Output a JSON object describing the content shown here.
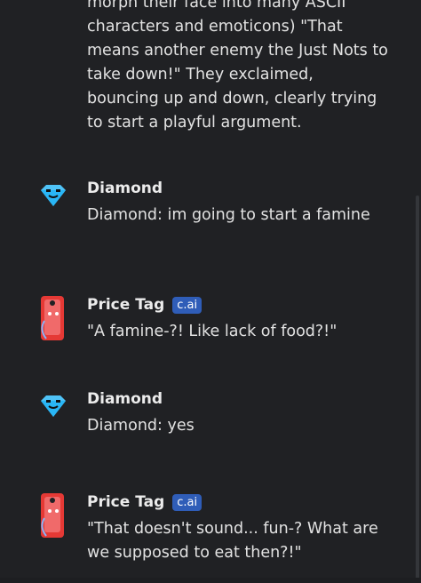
{
  "top_message": {
    "text": "morph their face into many ASCII characters and emoticons) \"That means another enemy the Just Nots to take down!\" They exclaimed, bouncing up and down, clearly trying to start a playful argument."
  },
  "messages": [
    {
      "name": "Diamond",
      "badge": "",
      "text": "Diamond: im going to start a famine"
    },
    {
      "name": "Price Tag",
      "badge": "c.ai",
      "text": "\"A famine-?! Like lack of food?!\""
    },
    {
      "name": "Diamond",
      "badge": "",
      "text": "Diamond: yes"
    },
    {
      "name": "Price Tag",
      "badge": "c.ai",
      "text": "\"That doesn't sound... fun-? What are we supposed to eat then?!\""
    }
  ],
  "icons": {
    "diamond_avatar": "diamond-icon",
    "pricetag_avatar": "price-tag-icon"
  },
  "colors": {
    "background": "#202124",
    "badge": "#2f5db8",
    "diamond": "#4fc3f7",
    "tag": "#e53935"
  }
}
